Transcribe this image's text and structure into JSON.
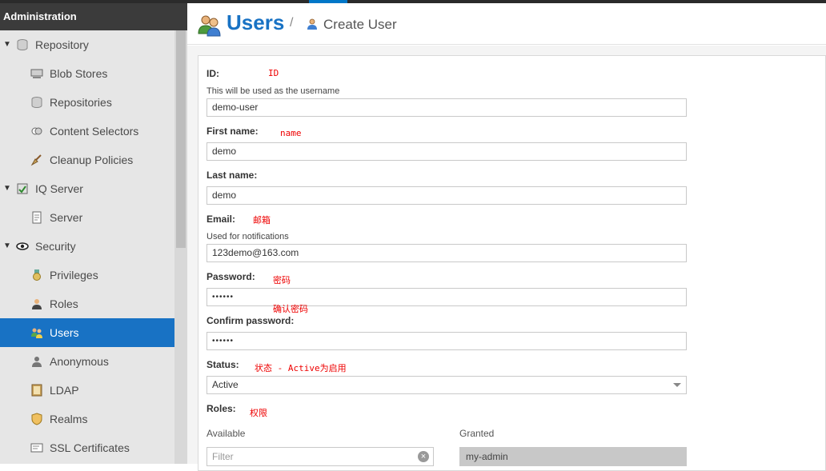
{
  "sidebar": {
    "header": "Administration",
    "items": [
      {
        "label": "Repository",
        "level": 1,
        "expanded": true,
        "icon": "database-icon"
      },
      {
        "label": "Blob Stores",
        "level": 2,
        "icon": "server-icon"
      },
      {
        "label": "Repositories",
        "level": 2,
        "icon": "database-icon"
      },
      {
        "label": "Content Selectors",
        "level": 2,
        "icon": "selector-icon"
      },
      {
        "label": "Cleanup Policies",
        "level": 2,
        "icon": "broom-icon"
      },
      {
        "label": "IQ Server",
        "level": 1,
        "expanded": true,
        "icon": "iq-server-icon"
      },
      {
        "label": "Server",
        "level": 2,
        "icon": "document-icon"
      },
      {
        "label": "Security",
        "level": 1,
        "expanded": true,
        "icon": "eye-icon"
      },
      {
        "label": "Privileges",
        "level": 2,
        "icon": "medal-icon"
      },
      {
        "label": "Roles",
        "level": 2,
        "icon": "role-icon"
      },
      {
        "label": "Users",
        "level": 2,
        "active": true,
        "icon": "users-icon"
      },
      {
        "label": "Anonymous",
        "level": 2,
        "icon": "person-icon"
      },
      {
        "label": "LDAP",
        "level": 2,
        "icon": "book-icon"
      },
      {
        "label": "Realms",
        "level": 2,
        "icon": "shield-icon"
      },
      {
        "label": "SSL Certificates",
        "level": 2,
        "icon": "certificate-icon"
      }
    ]
  },
  "header": {
    "title": "Users",
    "separator": "/",
    "crumb": "Create User"
  },
  "form": {
    "id": {
      "label": "ID:",
      "help": "This will be used as the username",
      "value": "demo-user",
      "note": "ID"
    },
    "first_name": {
      "label": "First name:",
      "value": "demo",
      "note": "name"
    },
    "last_name": {
      "label": "Last name:",
      "value": "demo"
    },
    "email": {
      "label": "Email:",
      "help": "Used for notifications",
      "value": "123demo@163.com",
      "note": "邮箱"
    },
    "password": {
      "label": "Password:",
      "value": "••••••",
      "note": "密码"
    },
    "confirm_password": {
      "label": "Confirm password:",
      "value": "••••••",
      "note": "确认密码"
    },
    "status": {
      "label": "Status:",
      "value": "Active",
      "note": "状态 - Active为启用"
    },
    "roles": {
      "label": "Roles:",
      "note": "权限",
      "available_label": "Available",
      "granted_label": "Granted",
      "filter_placeholder": "Filter",
      "granted": [
        "my-admin"
      ]
    }
  }
}
